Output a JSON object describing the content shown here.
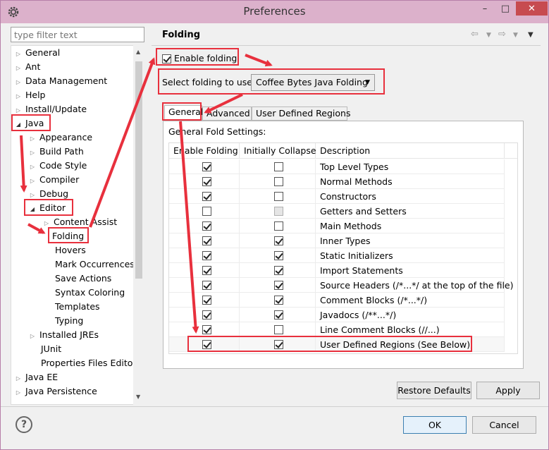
{
  "window": {
    "title": "Preferences",
    "minimize": "–",
    "maximize": "□",
    "close": "✕"
  },
  "filter": {
    "placeholder": "type filter text"
  },
  "tree": {
    "general": "General",
    "ant": "Ant",
    "data_management": "Data Management",
    "help": "Help",
    "install_update": "Install/Update",
    "java": "Java",
    "appearance": "Appearance",
    "build_path": "Build Path",
    "code_style": "Code Style",
    "compiler": "Compiler",
    "debug": "Debug",
    "editor": "Editor",
    "content_assist": "Content Assist",
    "folding": "Folding",
    "hovers": "Hovers",
    "mark_occurrences": "Mark Occurrences",
    "save_actions": "Save Actions",
    "syntax_coloring": "Syntax Coloring",
    "templates": "Templates",
    "typing": "Typing",
    "installed_jres": "Installed JREs",
    "junit": "JUnit",
    "properties_files_editor": "Properties Files Editor",
    "java_ee": "Java EE",
    "java_persistence": "Java Persistence"
  },
  "page": {
    "title": "Folding",
    "enable_folding_label": "Enable folding",
    "enable_folding_checked": true,
    "select_label": "Select folding to use:",
    "select_value": "Coffee Bytes Java Folding"
  },
  "tabs": {
    "general": "General",
    "advanced": "Advanced",
    "user_defined_regions": "User Defined Regions"
  },
  "panel": {
    "section_title": "General Fold Settings:",
    "columns": [
      "Enable Folding",
      "Initially Collapse",
      "Description"
    ],
    "rows": [
      {
        "enable": true,
        "collapse": false,
        "collapse_disabled": false,
        "desc": "Top Level Types"
      },
      {
        "enable": true,
        "collapse": false,
        "collapse_disabled": false,
        "desc": "Normal Methods"
      },
      {
        "enable": true,
        "collapse": false,
        "collapse_disabled": false,
        "desc": "Constructors"
      },
      {
        "enable": false,
        "collapse": false,
        "collapse_disabled": true,
        "desc": "Getters and Setters"
      },
      {
        "enable": true,
        "collapse": false,
        "collapse_disabled": false,
        "desc": "Main Methods"
      },
      {
        "enable": true,
        "collapse": true,
        "collapse_disabled": false,
        "desc": "Inner Types"
      },
      {
        "enable": true,
        "collapse": true,
        "collapse_disabled": false,
        "desc": "Static Initializers"
      },
      {
        "enable": true,
        "collapse": true,
        "collapse_disabled": false,
        "desc": "Import Statements"
      },
      {
        "enable": true,
        "collapse": true,
        "collapse_disabled": false,
        "desc": "Source Headers (/*...*/ at the top of the file)"
      },
      {
        "enable": true,
        "collapse": true,
        "collapse_disabled": false,
        "desc": "Comment Blocks (/*...*/)"
      },
      {
        "enable": true,
        "collapse": true,
        "collapse_disabled": false,
        "desc": "Javadocs (/**...*/)"
      },
      {
        "enable": true,
        "collapse": false,
        "collapse_disabled": false,
        "desc": "Line Comment Blocks (//...)"
      },
      {
        "enable": true,
        "collapse": true,
        "collapse_disabled": false,
        "desc": "User Defined Regions (See Below)"
      }
    ]
  },
  "buttons": {
    "restore_defaults": "Restore Defaults",
    "apply": "Apply",
    "ok": "OK",
    "cancel": "Cancel"
  },
  "colors": {
    "annotation_red": "#e8303d",
    "titlebar": "#dcb1cb",
    "close": "#c74b50"
  }
}
